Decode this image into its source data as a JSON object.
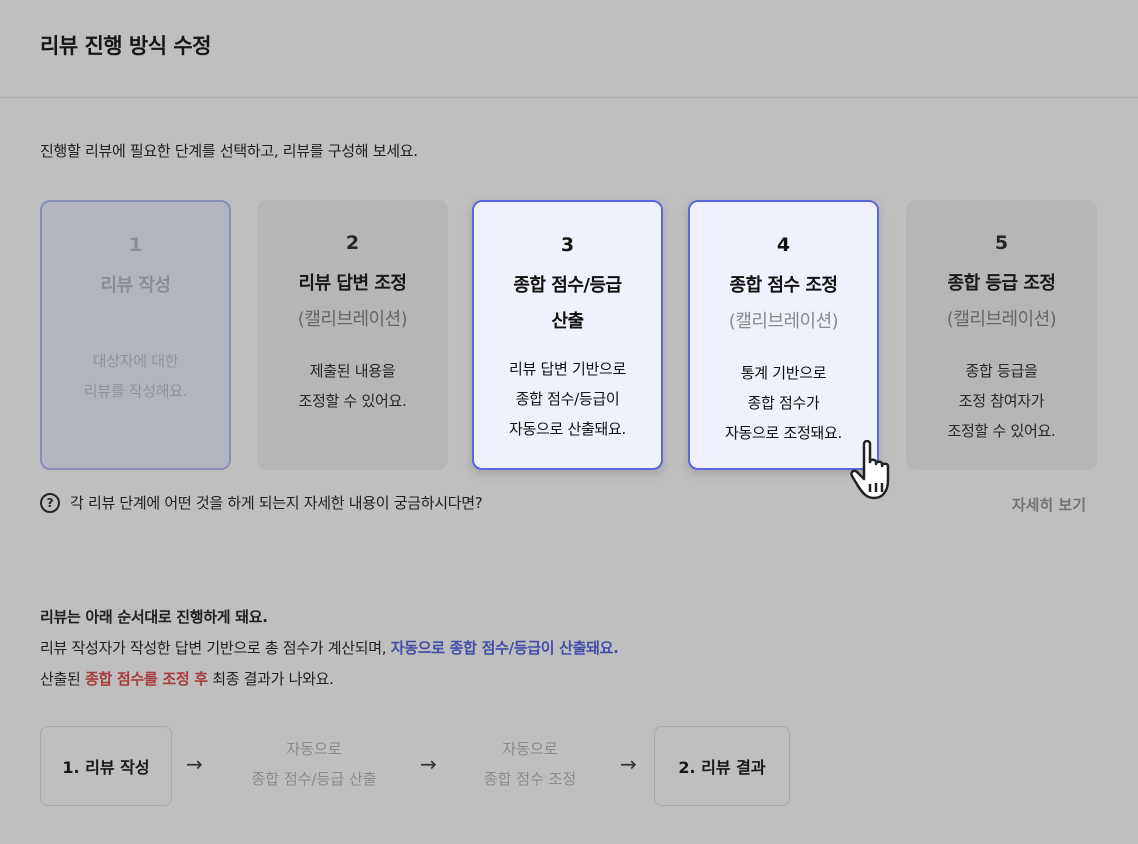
{
  "header": {
    "title": "리뷰 진행 방식 수정"
  },
  "intro": "진행할 리뷰에 필요한 단계를 선택하고, 리뷰를 구성해 보세요.",
  "cards": [
    {
      "num": "1",
      "name": "리뷰 작성",
      "sub": "",
      "desc": [
        "대상자에 대한",
        "리뷰를 작성해요."
      ]
    },
    {
      "num": "2",
      "name": "리뷰 답변 조정",
      "sub": "(캘리브레이션)",
      "desc": [
        "제출된 내용을",
        "조정할 수 있어요."
      ]
    },
    {
      "num": "3",
      "name_lines": [
        "종합 점수/등급",
        "산출"
      ],
      "desc": [
        "리뷰 답변 기반으로",
        "종합 점수/등급이",
        "자동으로 산출돼요."
      ]
    },
    {
      "num": "4",
      "name": "종합 점수 조정",
      "sub": "(캘리브레이션)",
      "desc": [
        "통계 기반으로",
        "종합 점수가",
        "자동으로 조정돼요."
      ]
    },
    {
      "num": "5",
      "name": "종합 등급 조정",
      "sub": "(캘리브레이션)",
      "desc": [
        "종합 등급을",
        "조정 참여자가",
        "조정할 수 있어요."
      ]
    }
  ],
  "help": {
    "icon": "?",
    "text": "각 리뷰 단계에 어떤 것을 하게 되는지 자세한 내용이 궁금하시다면?",
    "more": "자세히 보기"
  },
  "order": {
    "line1": "리뷰는 아래 순서대로 진행하게 돼요.",
    "line2_prefix": "리뷰 작성자가 작성한 답변 기반으로 총 점수가 계산되며, ",
    "line2_highlight": "자동으로 종합 점수/등급이 산출돼요.",
    "line3_prefix": "산출된 ",
    "line3_highlight": "종합 점수를 조정 후",
    "line3_suffix": " 최종 결과가 나와요."
  },
  "flow": {
    "step1": "1. 리뷰 작성",
    "auto1": [
      "자동으로",
      "종합 점수/등급 산출"
    ],
    "auto2": [
      "자동으로",
      "종합 점수 조정"
    ],
    "step2": "2. 리뷰 결과",
    "arrow": "→"
  },
  "colors": {
    "accent": "#5b66e0",
    "highlight_red": "#e05050",
    "selected_bg": "#f0f1ff"
  }
}
